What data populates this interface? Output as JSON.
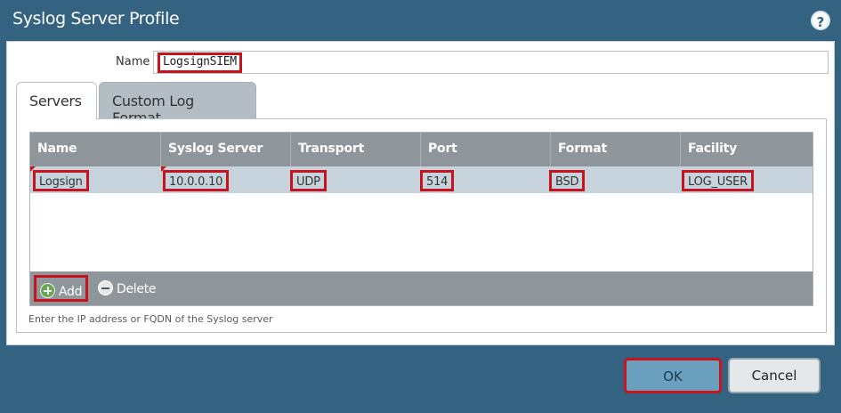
{
  "dialog": {
    "title": "Syslog Server Profile",
    "help_icon": "question-circle-icon"
  },
  "name_field": {
    "label": "Name",
    "value": "LogsignSIEM"
  },
  "tabs": [
    {
      "label": "Servers",
      "active": true
    },
    {
      "label": "Custom Log Format",
      "active": false
    }
  ],
  "servers_table": {
    "columns": [
      "Name",
      "Syslog Server",
      "Transport",
      "Port",
      "Format",
      "Facility"
    ],
    "rows": [
      {
        "name": "Logsign",
        "syslog_server": "10.0.0.10",
        "transport": "UDP",
        "port": "514",
        "format": "BSD",
        "facility": "LOG_USER"
      }
    ]
  },
  "toolbar": {
    "add_label": "Add",
    "add_icon": "plus-circle-icon",
    "delete_label": "Delete",
    "delete_icon": "minus-circle-icon"
  },
  "hint": "Enter the IP address or FQDN of the Syslog server",
  "buttons": {
    "ok_label": "OK",
    "cancel_label": "Cancel"
  },
  "colors": {
    "dialog_background": "#336380",
    "header_gray": "#8e969b",
    "selected_row": "#c6d3dc",
    "highlight_red": "#c8131d",
    "ok_button": "#6a9fbd"
  }
}
